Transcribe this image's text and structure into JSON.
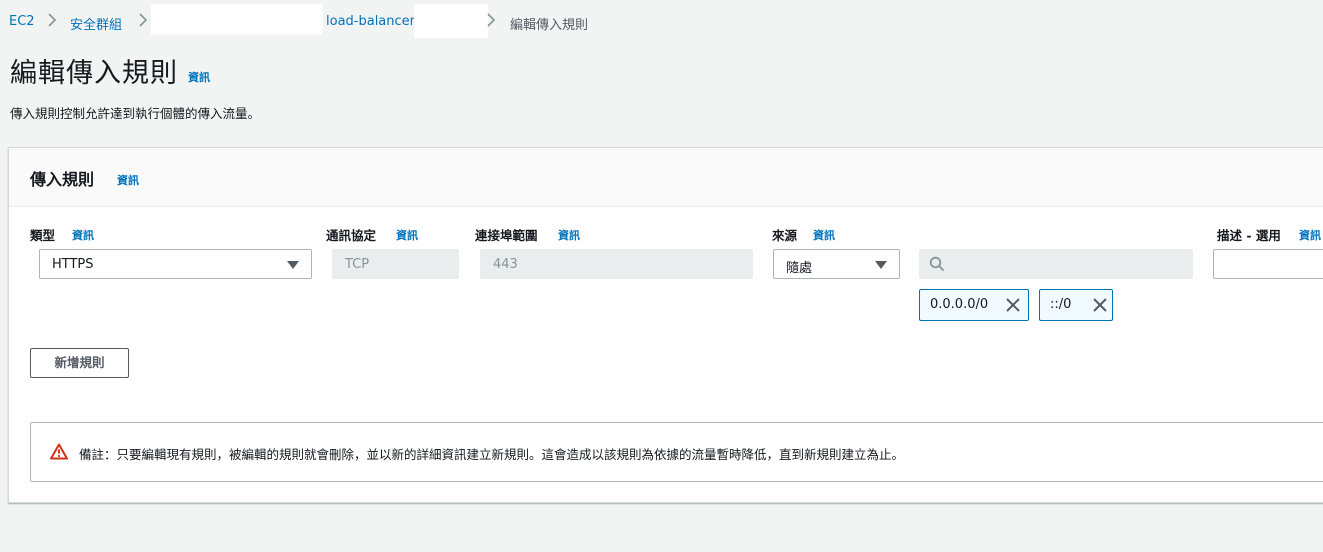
{
  "breadcrumb": {
    "ec2": "EC2",
    "security_groups": "安全群組",
    "sg_name": "load-balancer",
    "current": "編輯傳入規則"
  },
  "header": {
    "title": "編輯傳入規則",
    "info": "資訊",
    "description": "傳入規則控制允許達到執行個體的傳入流量。"
  },
  "panel": {
    "title": "傳入規則",
    "info": "資訊",
    "columns": {
      "type": "類型",
      "protocol": "通訊協定",
      "port_range": "連接埠範圍",
      "source": "來源",
      "description": "描述 - 選用",
      "info": "資訊"
    },
    "rule": {
      "type": "HTTPS",
      "protocol": "TCP",
      "port_range": "443",
      "source_type": "隨處",
      "search_placeholder": "",
      "description": "",
      "cidrs": [
        "0.0.0.0/0",
        "::/0"
      ]
    },
    "add_rule_button": "新增規則",
    "alert": "備註：只要編輯現有規則，被編輯的規則就會刪除，並以新的詳細資訊建立新規則。這會造成以該規則為依據的流量暫時降低，直到新規則建立為止。"
  },
  "colors": {
    "link": "#0073bb",
    "token_border": "#0073bb",
    "warning": "#d13212"
  },
  "icons": [
    "chevron-right-icon",
    "caret-down-icon",
    "search-icon",
    "close-icon",
    "warning-icon"
  ]
}
